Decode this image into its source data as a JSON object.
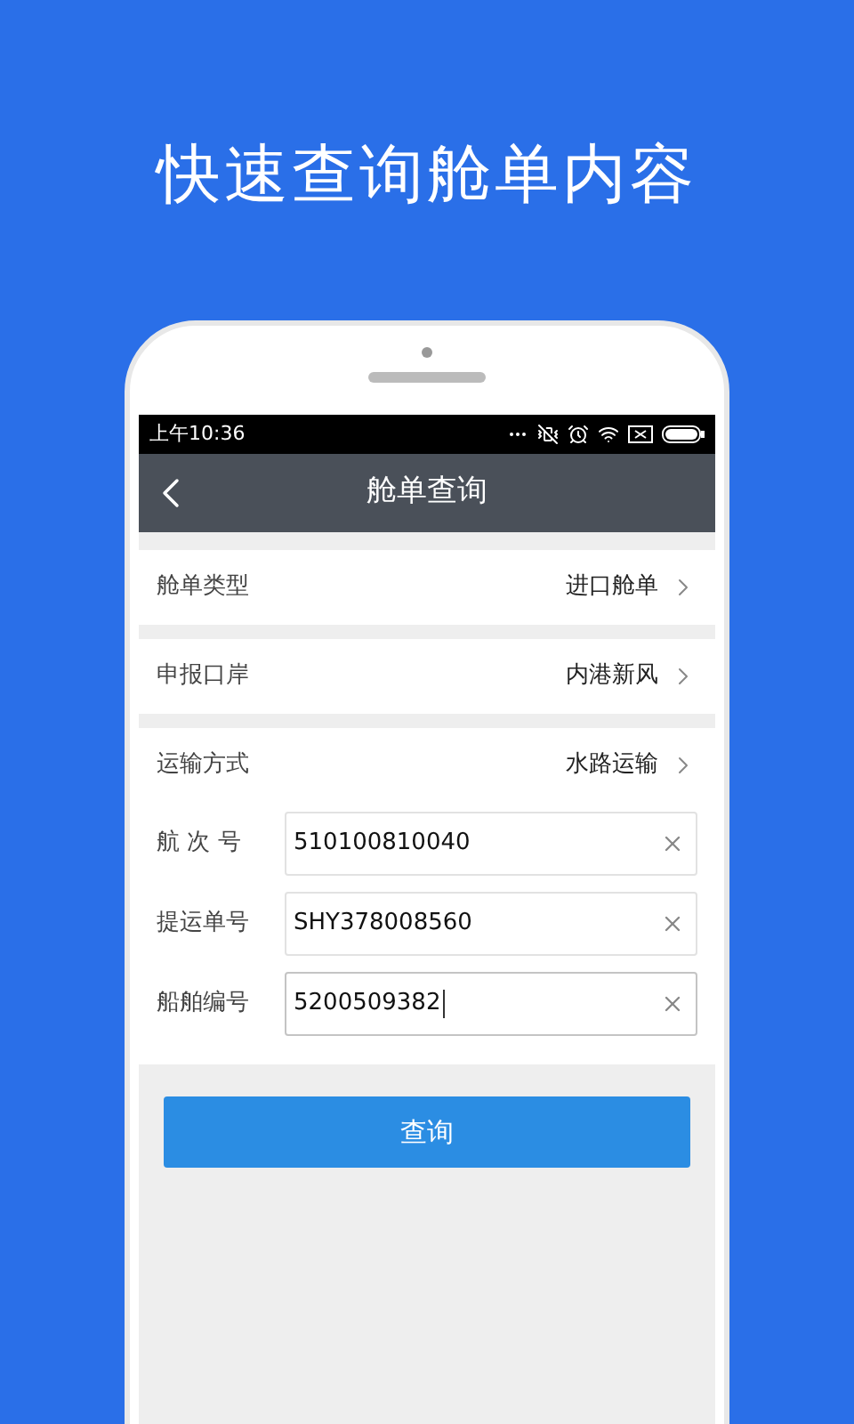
{
  "headline": "快速查询舱单内容",
  "status_bar": {
    "time": "上午10:36"
  },
  "nav": {
    "title": "舱单查询"
  },
  "rows": [
    {
      "kind": "select",
      "label": "舱单类型",
      "value": "进口舱单"
    },
    {
      "kind": "select",
      "label": "申报口岸",
      "value": "内港新风"
    },
    {
      "kind": "select",
      "label": "运输方式",
      "value": "水路运输"
    },
    {
      "kind": "input",
      "label": "航 次 号",
      "value": "510100810040",
      "focused": false
    },
    {
      "kind": "input",
      "label": "提运单号",
      "value": "SHY378008560",
      "focused": false
    },
    {
      "kind": "input",
      "label": "船舶编号",
      "value": "5200509382",
      "focused": true
    }
  ],
  "submit": "查询"
}
